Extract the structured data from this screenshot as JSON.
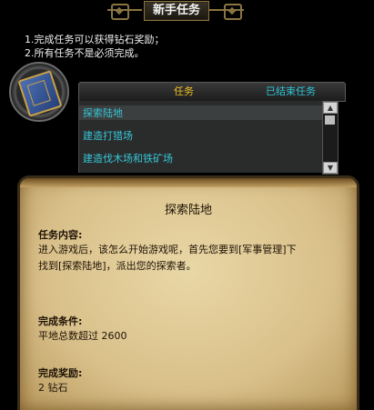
{
  "header": {
    "title": "新手任务"
  },
  "rules": [
    "1.完成任务可以获得钻石奖励；",
    "2.所有任务不是必须完成。"
  ],
  "tabs": {
    "active": "任务",
    "ended": "已结束任务"
  },
  "task_list": [
    {
      "label": "探索陆地"
    },
    {
      "label": "建造打猎场"
    },
    {
      "label": "建造伐木场和铁矿场"
    }
  ],
  "detail": {
    "title": "探索陆地",
    "content_heading": "任务内容:",
    "content_line1": "进入游戏后，该怎么开始游戏呢，首先您要到[军事管理]下",
    "content_line2": "找到[探索陆地]，派出您的探索者。",
    "condition_heading": "完成条件:",
    "condition_text": "平地总数超过  2600",
    "reward_heading": "完成奖励:",
    "reward_text": "2 钻石"
  },
  "icons": {
    "book": "task-book-icon",
    "scroll_up": "arrow-up-icon",
    "scroll_down": "arrow-down-icon"
  },
  "colors": {
    "tab_active": "#f0c020",
    "tab_ended": "#2ec5d8",
    "list_text": "#37c6d7"
  }
}
